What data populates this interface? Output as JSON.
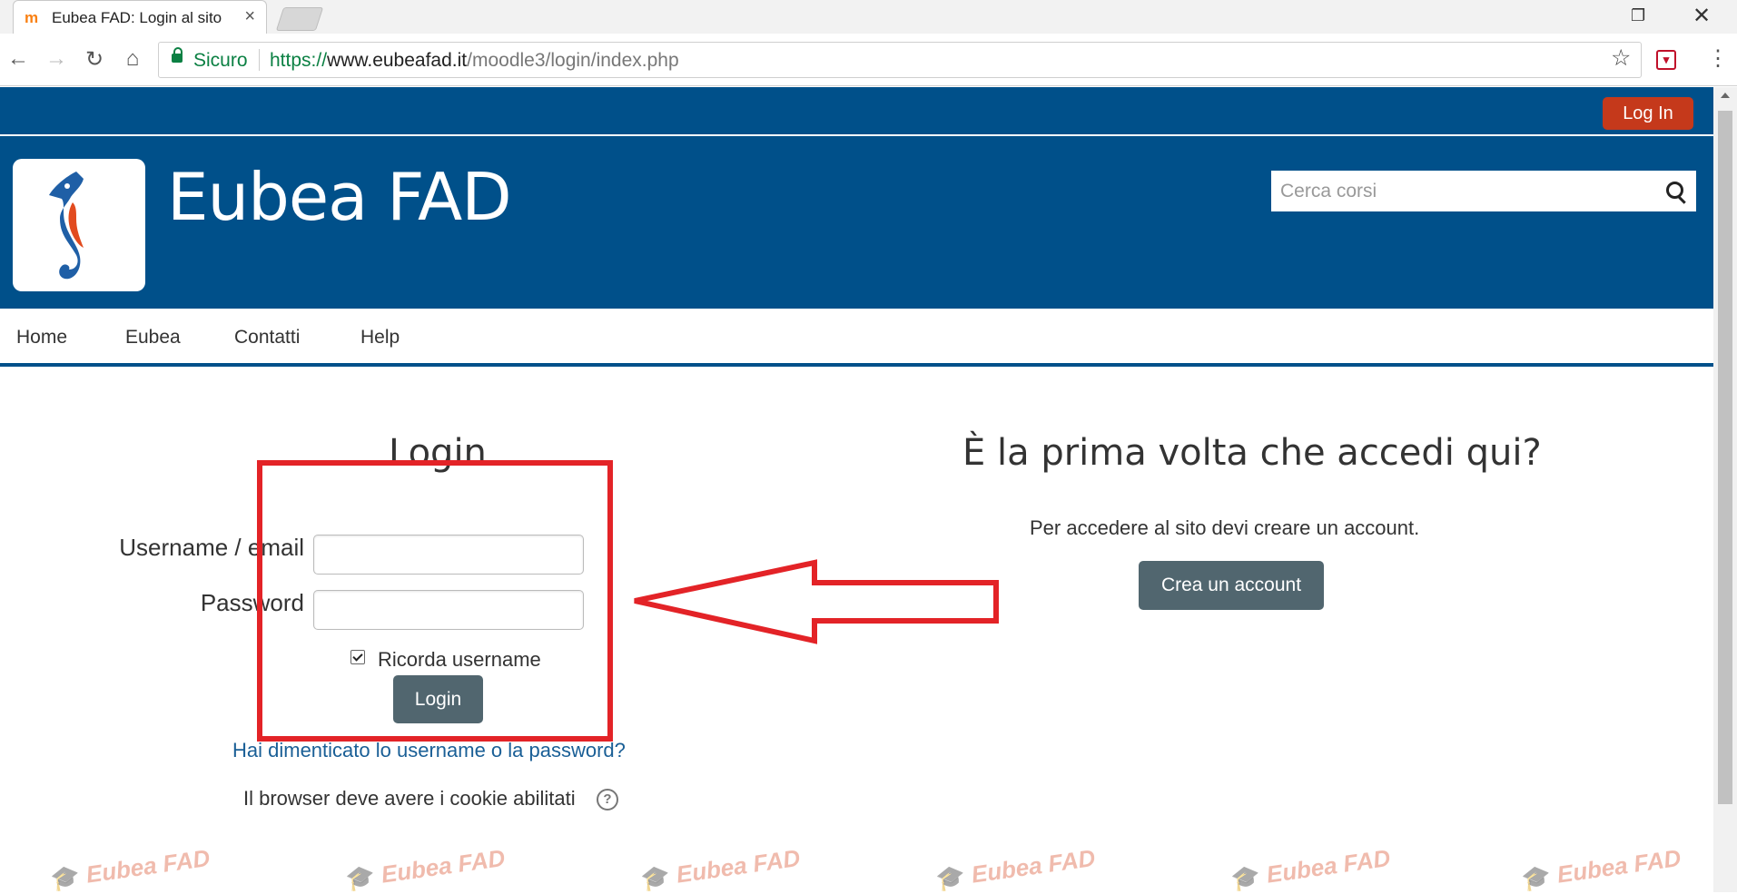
{
  "browser": {
    "tab_title": "Eubea FAD: Login al sito",
    "tab_favicon": "m",
    "close_glyph": "×",
    "secure_label": "Sicuro",
    "url_protocol": "https://",
    "url_host": "www.eubeafad.it",
    "url_path": "/moodle3/login/index.php",
    "back_glyph": "←",
    "forward_glyph": "→",
    "reload_glyph": "↻",
    "home_glyph": "⌂",
    "star_glyph": "☆",
    "menu_glyph": "⋮",
    "restore_glyph": "❐",
    "window_close_glyph": "✕",
    "extension_glyph": "☐"
  },
  "topbar": {
    "login_button": "Log In"
  },
  "header": {
    "site_name": "Eubea FAD",
    "search_placeholder": "Cerca corsi"
  },
  "nav": {
    "items": [
      {
        "label": "Home"
      },
      {
        "label": "Eubea"
      },
      {
        "label": "Contatti"
      },
      {
        "label": "Help"
      }
    ]
  },
  "login": {
    "heading": "Login",
    "username_label": "Username / email",
    "username_value": "",
    "password_label": "Password",
    "password_value": "",
    "remember_label": "Ricorda username",
    "remember_checked": true,
    "submit_label": "Login",
    "forgot_link": "Hai dimenticato lo username o la password?",
    "cookies_text": "Il browser deve avere i cookie abilitati",
    "help_glyph": "?"
  },
  "signup": {
    "heading": "È la prima volta che accedi qui?",
    "description": "Per accedere al sito devi creare un account.",
    "create_button": "Crea un account"
  },
  "watermark": {
    "text": "Eubea FAD"
  },
  "colors": {
    "brand_blue": "#00508a",
    "login_top_button": "#c5391b",
    "button_gray": "#51666f",
    "annotation_red": "#e32327",
    "link_blue": "#1a5f96"
  },
  "icons": [
    "lock-icon",
    "star-icon",
    "search-icon",
    "seahorse-logo",
    "help-icon",
    "checkbox-checked-icon"
  ]
}
